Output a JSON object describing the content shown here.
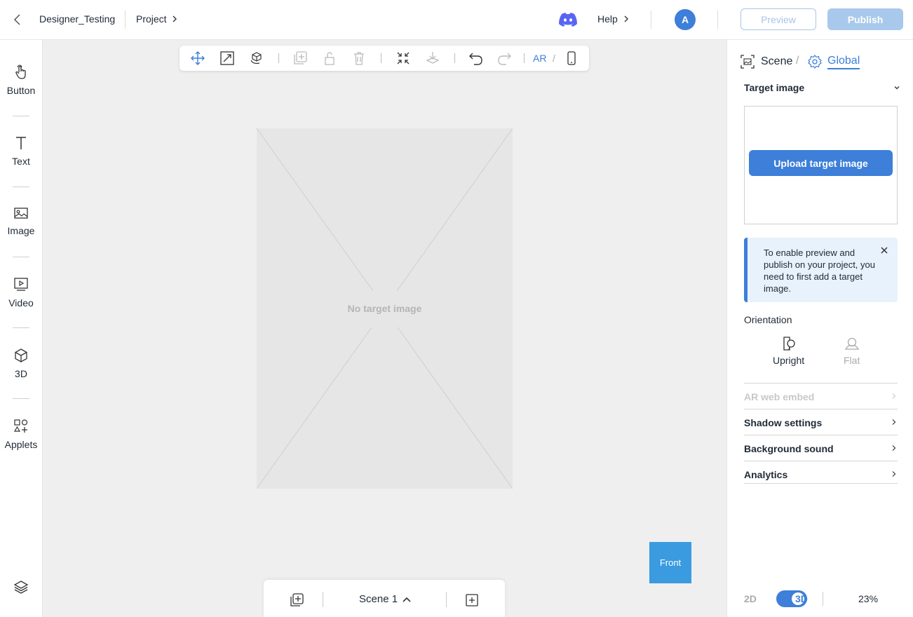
{
  "topbar": {
    "project_name": "Designer_Testing",
    "project_menu": "Project",
    "help": "Help",
    "avatar_initial": "A",
    "preview_label": "Preview",
    "publish_label": "Publish"
  },
  "sidebar": {
    "items": [
      {
        "label": "Button",
        "icon": "hand-pointer-icon"
      },
      {
        "label": "Text",
        "icon": "text-icon"
      },
      {
        "label": "Image",
        "icon": "image-icon"
      },
      {
        "label": "Video",
        "icon": "video-icon"
      },
      {
        "label": "3D",
        "icon": "cube-icon"
      },
      {
        "label": "Applets",
        "icon": "applets-icon"
      }
    ]
  },
  "toolbar": {
    "tools": [
      "move-icon",
      "scale-icon",
      "rotate-icon",
      "duplicate-icon",
      "lock-icon",
      "delete-icon",
      "shrink-icon",
      "drop-icon",
      "undo-icon",
      "redo-icon"
    ],
    "ar_label": "AR",
    "separator": "/"
  },
  "canvas": {
    "no_target_text": "No target image",
    "front_label": "Front"
  },
  "scenebar": {
    "scene_label": "Scene 1"
  },
  "rpanel": {
    "tab_scene": "Scene",
    "tab_separator": "/",
    "tab_global": "Global",
    "target_image_title": "Target image",
    "upload_label": "Upload target image",
    "info_text": "To enable preview and publish on your project, you need to first add a target image.",
    "orientation_label": "Orientation",
    "orientation_options": [
      {
        "label": "Upright",
        "selected": true
      },
      {
        "label": "Flat",
        "selected": false
      }
    ],
    "rows": [
      {
        "label": "AR web embed",
        "disabled": true
      },
      {
        "label": "Shadow settings",
        "disabled": false
      },
      {
        "label": "Background sound",
        "disabled": false
      },
      {
        "label": "Analytics",
        "disabled": false
      }
    ],
    "dim_2d": "2D",
    "dim_3d": "3D",
    "zoom": "23%"
  },
  "colors": {
    "accent": "#3d7fd9",
    "front_bg": "#3a9be0",
    "canvas_bg": "#efefef",
    "info_bg": "#e8f2fc"
  }
}
